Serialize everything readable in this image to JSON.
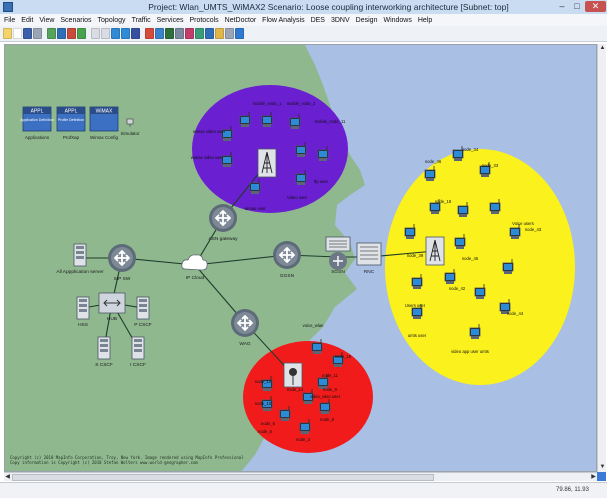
{
  "window": {
    "title": "Project: Wlan_UMTS_WiMAX2 Scenario: Loose coupling interworking architecture [Subnet: top]",
    "min_label": "–",
    "max_label": "□",
    "close_label": "✕"
  },
  "menu": [
    "File",
    "Edit",
    "View",
    "Scenarios",
    "Topology",
    "Traffic",
    "Services",
    "Protocols",
    "NetDoctor",
    "Flow Analysis",
    "DES",
    "3DNV",
    "Design",
    "Windows",
    "Help"
  ],
  "toolbar_icons": [
    "open-icon",
    "new-icon",
    "save-icon",
    "print-icon",
    "object-palette-icon",
    "link-icon",
    "failure-icon",
    "recover-icon",
    "zoom-in-icon",
    "zoom-out-icon",
    "import-icon",
    "export-icon",
    "filter-icon",
    "chart-icon",
    "configure-icon",
    "run-icon",
    "results-icon",
    "web-report-icon",
    "flow-icon",
    "config-icon",
    "layers-icon",
    "help-icon",
    "window-icon"
  ],
  "config_objects": [
    {
      "badge": "APPL",
      "label": "Application Definition",
      "caption": "Applications"
    },
    {
      "badge": "APPL",
      "label": "Profile Definition",
      "caption": "ProfXap"
    },
    {
      "badge": "WiMAX",
      "label": "",
      "caption": "Wimax Config"
    }
  ],
  "simulator_label": "Simulator",
  "nodes": {
    "all_app_server": "All Appplication server",
    "p_ip_sw": "SIP SW",
    "hss": "HSS",
    "hub": "HUB",
    "p_cscf": "P CSCF",
    "s_cscf": "S CSCF",
    "i_cscf": "I CSCF",
    "ip_cloud": "IP Cloud",
    "asn_gateway": "ASN gateway",
    "wag": "WAG",
    "ggsn": "GGSN",
    "sgsn": "SGSN",
    "rnc": "RNC"
  },
  "wimax_nodes": [
    "mobile_node_1",
    "mobile_node_2",
    "mobile_node_11",
    "wimax video user",
    "wimax video user",
    "ftp user",
    "Video user",
    "wimax user"
  ],
  "umts_nodes": [
    "node_34",
    "node_46",
    "node_33",
    "node_18",
    "Voice users",
    "node_43",
    "node_39",
    "node_45",
    "node_42",
    "Users user",
    "node_44",
    "video app user umts",
    "umts user"
  ],
  "wlan_nodes": [
    "voice_wlan",
    "node_15",
    "node_11",
    "node_12",
    "node_9",
    "node_10",
    "node_14",
    "node_6",
    "node_5",
    "video_wlan user",
    "node_8",
    "node_3"
  ],
  "copyright": [
    "Copyright (c) 2018 MapInfo Corporation, Troy, New York. Image rendered using MapInfo Professional",
    "Copy information is Copyright (c) 2018 Stefan Wolters www.world-geographer.com"
  ],
  "status": "79.86, 11.93",
  "colors": {
    "land": "#8fb88f",
    "sea": "#a9bfe4",
    "wimax_zone": "#6a1fd1",
    "umts_zone": "#fbf11c",
    "wlan_zone": "#f11b1b"
  }
}
